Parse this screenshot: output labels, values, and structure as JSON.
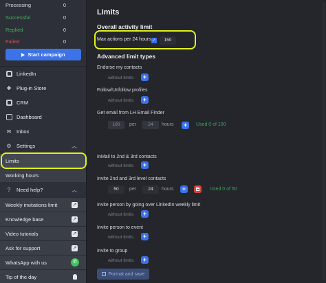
{
  "sidebar": {
    "stats": [
      {
        "label": "Processing",
        "value": "0",
        "color": "#d8dadf"
      },
      {
        "label": "Successful",
        "value": "0",
        "color": "#3fb05a"
      },
      {
        "label": "Replied",
        "value": "0",
        "color": "#3fb05a"
      },
      {
        "label": "Failed",
        "value": "0",
        "color": "#e0504a"
      }
    ],
    "campaign_button": "Start campaign",
    "nav": [
      {
        "label": "LinkedIn",
        "icon": "linkedin-icon"
      },
      {
        "label": "Plug-in Store",
        "icon": "puzzle-icon"
      },
      {
        "label": "CRM",
        "icon": "crm-icon"
      },
      {
        "label": "Dashboard",
        "icon": "dashboard-icon"
      },
      {
        "label": "Inbox",
        "icon": "inbox-icon"
      },
      {
        "label": "Settings",
        "icon": "gear-icon"
      }
    ],
    "settings_sub": [
      "Limits",
      "Working hours"
    ],
    "help": {
      "title": "Need help?",
      "items": [
        "Weekly invitations limit",
        "Knowledge base",
        "Video tutorials",
        "Ask for support",
        "WhatsApp with us",
        "Tip of the day"
      ]
    }
  },
  "main": {
    "title": "Limits",
    "overall_title": "Overall activity limit",
    "max_actions_label": "Max actions per 24 hours",
    "max_actions_value": "150",
    "advanced_title": "Advanced limit types",
    "without_limits": "without limits",
    "per": "per",
    "hours": "hours",
    "limits": [
      {
        "label": "Endorse my contacts"
      },
      {
        "label": "Follow/Unfollow profiles"
      },
      {
        "label": "Get email from LH Email Finder",
        "count": "100",
        "period": "24",
        "used": "Used 0 of 100"
      },
      {
        "label": "InMail to 2nd & 3rd contacts"
      },
      {
        "label": "Invite 2nd and 3rd level contacts",
        "count": "50",
        "period": "24",
        "used": "Used 0 of 50"
      },
      {
        "label": "Invite person by going over LinkedIn weekly limit"
      },
      {
        "label": "Invite person to event"
      },
      {
        "label": "Invite to group"
      }
    ],
    "save_button": "Format and save"
  },
  "colors": {
    "accent": "#3c73e8",
    "highlight": "#e3f21e",
    "success": "#3fa65a",
    "danger": "#d8453f"
  }
}
